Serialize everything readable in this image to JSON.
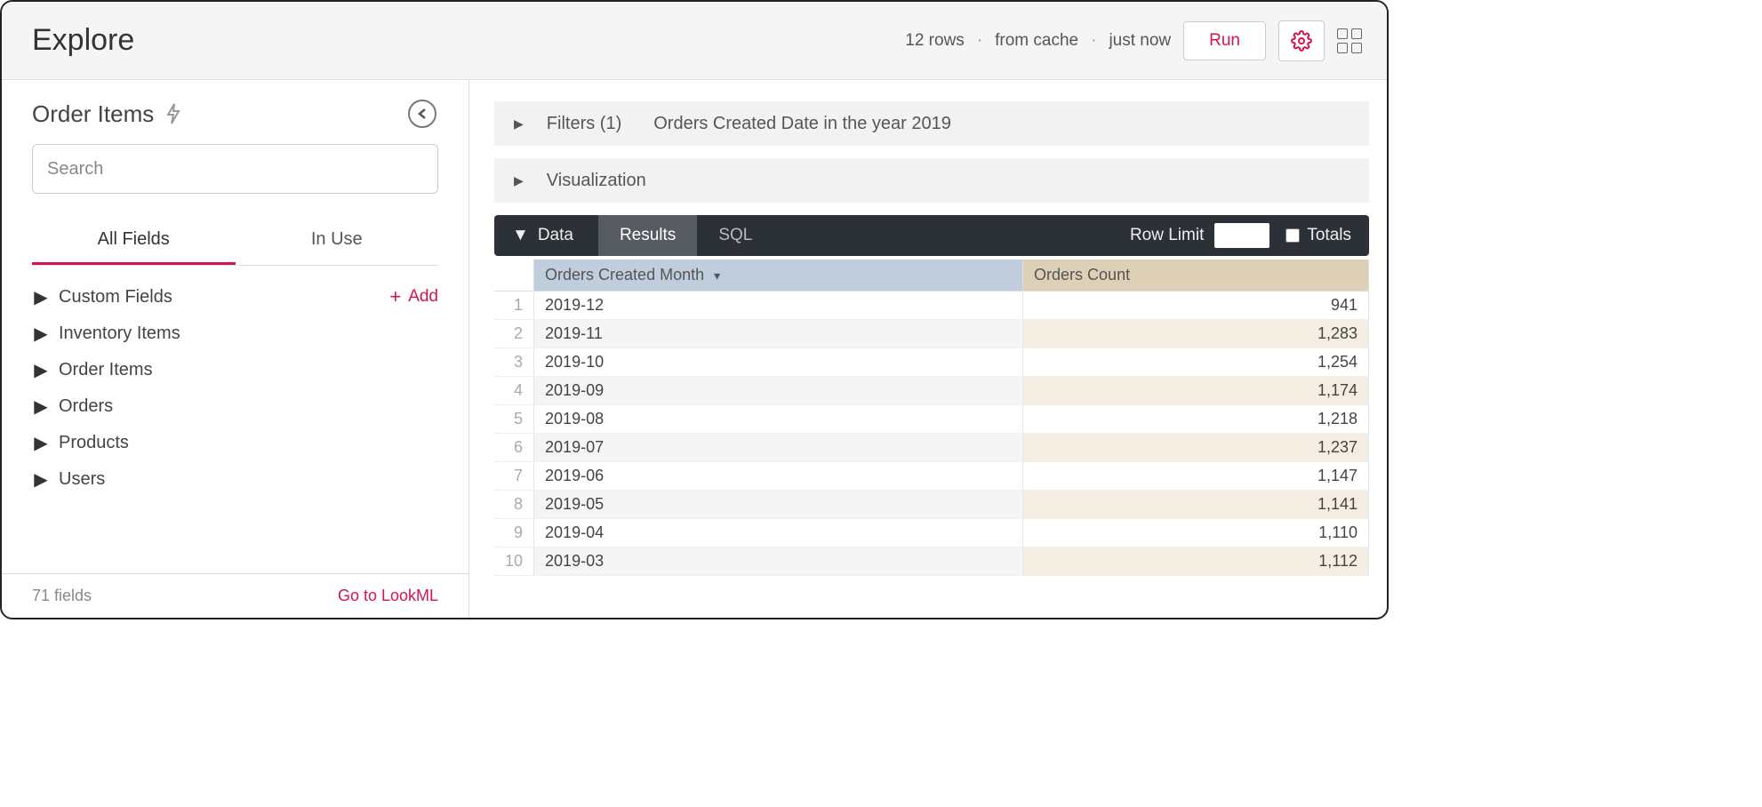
{
  "topbar": {
    "title": "Explore",
    "status_rows": "12 rows",
    "status_source": "from cache",
    "status_time": "just now",
    "run_label": "Run"
  },
  "left": {
    "explore_name": "Order Items",
    "search_placeholder": "Search",
    "tabs": {
      "all_fields": "All Fields",
      "in_use": "In Use"
    },
    "add_label": "Add",
    "groups": [
      "Custom Fields",
      "Inventory Items",
      "Order Items",
      "Orders",
      "Products",
      "Users"
    ],
    "footer_count": "71 fields",
    "lookml_link": "Go to LookML"
  },
  "right": {
    "filters_label": "Filters (1)",
    "filters_summary": "Orders Created Date in the year 2019",
    "visualization_label": "Visualization",
    "data_label": "Data",
    "tabs": {
      "results": "Results",
      "sql": "SQL"
    },
    "row_limit_label": "Row Limit",
    "row_limit_value": "",
    "totals_label": "Totals"
  },
  "table": {
    "headers": {
      "dim": "Orders Created Month",
      "meas": "Orders Count"
    },
    "rows": [
      {
        "n": "1",
        "dim": "2019-12",
        "meas": "941"
      },
      {
        "n": "2",
        "dim": "2019-11",
        "meas": "1,283"
      },
      {
        "n": "3",
        "dim": "2019-10",
        "meas": "1,254"
      },
      {
        "n": "4",
        "dim": "2019-09",
        "meas": "1,174"
      },
      {
        "n": "5",
        "dim": "2019-08",
        "meas": "1,218"
      },
      {
        "n": "6",
        "dim": "2019-07",
        "meas": "1,237"
      },
      {
        "n": "7",
        "dim": "2019-06",
        "meas": "1,147"
      },
      {
        "n": "8",
        "dim": "2019-05",
        "meas": "1,141"
      },
      {
        "n": "9",
        "dim": "2019-04",
        "meas": "1,110"
      },
      {
        "n": "10",
        "dim": "2019-03",
        "meas": "1,112"
      }
    ]
  }
}
